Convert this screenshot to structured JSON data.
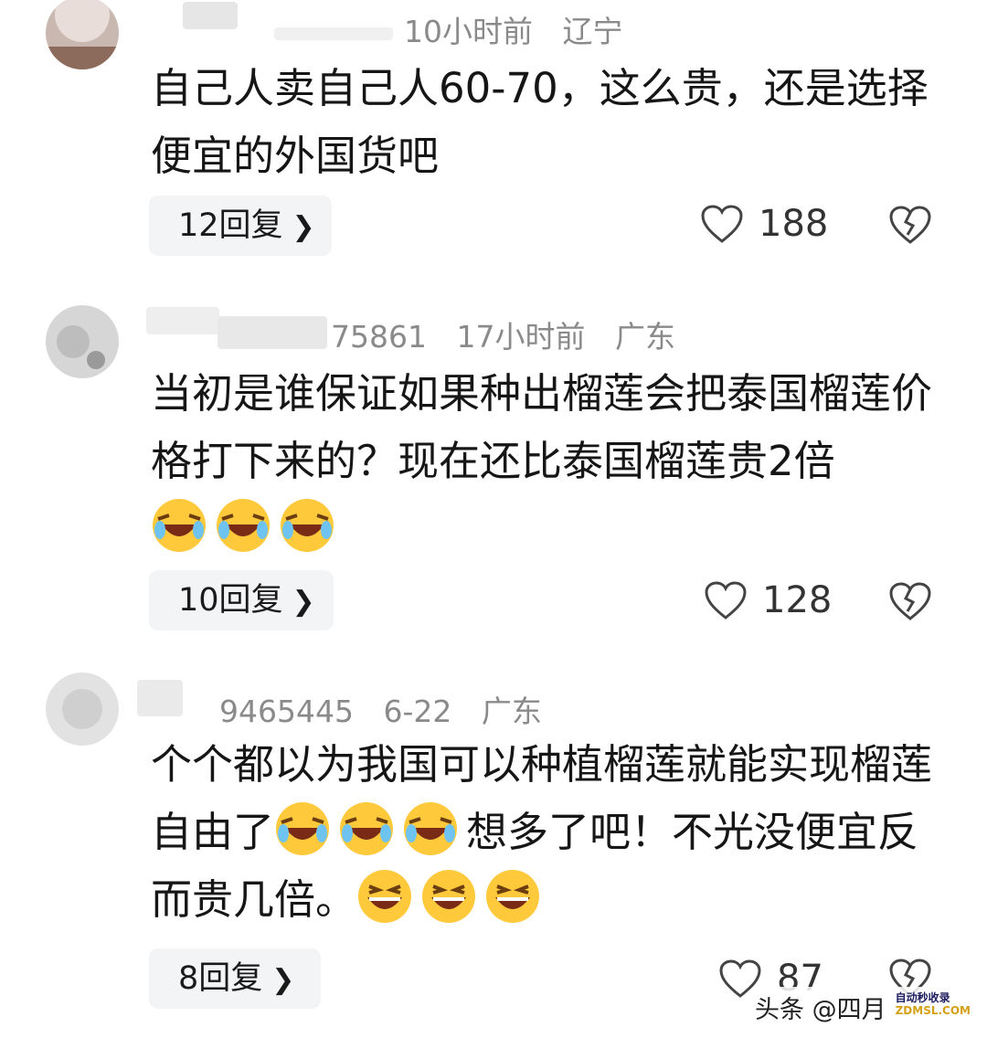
{
  "comments": [
    {
      "username_tail": "",
      "time": "10小时前",
      "location": "辽宁",
      "text": "自己人卖自己人60-70，这么贵，还是选择便宜的外国货吧",
      "replies": "12回复",
      "likes": "188"
    },
    {
      "username_tail": "75861",
      "time": "17小时前",
      "location": "广东",
      "text_part1": "当初是谁保证如果种出榴莲会把泰国榴莲价格打下来的？现在还比泰国榴莲贵2倍",
      "replies": "10回复",
      "likes": "128"
    },
    {
      "username_tail": "9465445",
      "time": "6-22",
      "location": "广东",
      "text_part1": "个个都以为我国可以种植榴莲就能实现榴莲自由了",
      "text_part2": "想多了吧！不光没便宜反而贵几倍。",
      "replies": "8回复",
      "likes": "87"
    }
  ],
  "icons": {
    "heart": "heart-icon",
    "broken_heart": "broken-heart-icon",
    "chevron": "chevron-right-icon",
    "emoji_laugh_cry": "laugh-cry-emoji",
    "emoji_grin": "grin-emoji"
  },
  "watermark": {
    "text": "头条 @四月",
    "logo_line1": "自动秒收录",
    "logo_line2": "ZDMSL.COM"
  },
  "colors": {
    "meta_gray": "#8a8a8a",
    "reply_bg": "#f3f4f6",
    "emoji_yellow": "#ffc93c"
  }
}
